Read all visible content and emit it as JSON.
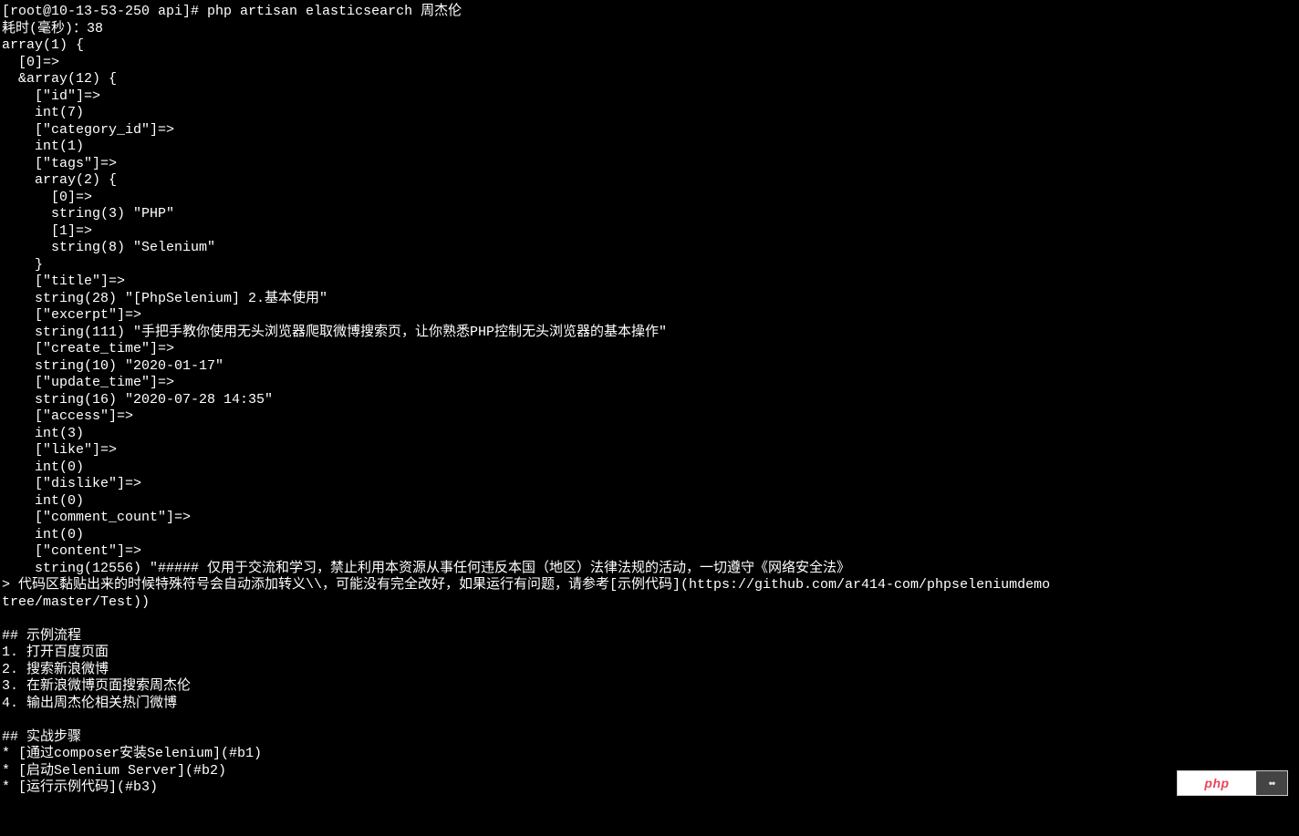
{
  "badge": {
    "left_text": "php",
    "right_text": "••"
  },
  "terminal": {
    "lines": [
      "[root@10-13-53-250 api]# php artisan elasticsearch 周杰伦",
      "耗时(毫秒)：38",
      "array(1) {",
      "  [0]=>",
      "  &array(12) {",
      "    [\"id\"]=>",
      "    int(7)",
      "    [\"category_id\"]=>",
      "    int(1)",
      "    [\"tags\"]=>",
      "    array(2) {",
      "      [0]=>",
      "      string(3) \"PHP\"",
      "      [1]=>",
      "      string(8) \"Selenium\"",
      "    }",
      "    [\"title\"]=>",
      "    string(28) \"[PhpSelenium] 2.基本使用\"",
      "    [\"excerpt\"]=>",
      "    string(111) \"手把手教你使用无头浏览器爬取微博搜索页，让你熟悉PHP控制无头浏览器的基本操作\"",
      "    [\"create_time\"]=>",
      "    string(10) \"2020-01-17\"",
      "    [\"update_time\"]=>",
      "    string(16) \"2020-07-28 14:35\"",
      "    [\"access\"]=>",
      "    int(3)",
      "    [\"like\"]=>",
      "    int(0)",
      "    [\"dislike\"]=>",
      "    int(0)",
      "    [\"comment_count\"]=>",
      "    int(0)",
      "    [\"content\"]=>",
      "    string(12556) \"##### 仅用于交流和学习，禁止利用本资源从事任何违反本国（地区）法律法规的活动，一切遵守《网络安全法》",
      "> 代码区黏贴出来的时候特殊符号会自动添加转义\\\\，可能没有完全改好，如果运行有问题，请参考[示例代码](https://github.com/ar414-com/phpseleniumdemo",
      "tree/master/Test))",
      "",
      "## 示例流程",
      "1. 打开百度页面",
      "2. 搜索新浪微博",
      "3. 在新浪微博页面搜索周杰伦",
      "4. 输出周杰伦相关热门微博",
      "",
      "## 实战步骤",
      "* [通过composer安装Selenium](#b1)",
      "* [启动Selenium Server](#b2)",
      "* [运行示例代码](#b3)"
    ]
  }
}
